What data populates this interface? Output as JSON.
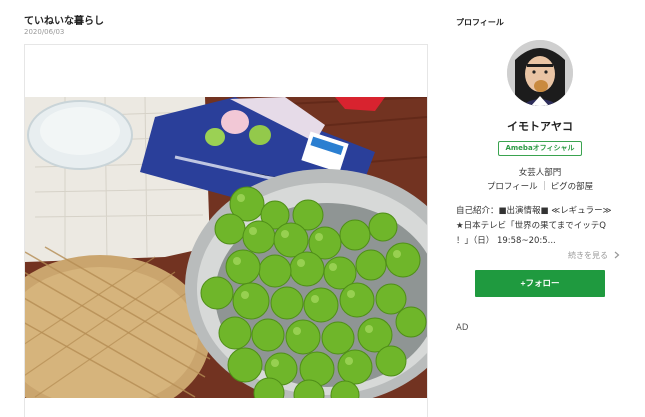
{
  "post": {
    "title": "ていねいな暮らし",
    "date": "2020/06/03"
  },
  "sidebar": {
    "heading": "プロフィール",
    "name": "イモトアヤコ",
    "badge": "Amebaオフィシャル",
    "category": "女芸人部門",
    "links": [
      {
        "label": "プロフィール"
      },
      {
        "label": "ピグの部屋"
      }
    ],
    "intro_lines": [
      "自己紹介：■出演情報■ ≪レギュラー≫",
      "★日本テレビ「世界の果てまでイッテQ",
      "！」（日） 19:58~20:5..."
    ],
    "more_label": "続きを見る",
    "more_icon": "chevron-right-icon",
    "follow_label": "+フォロー",
    "follow_color": "#1f9a3f",
    "ad_label": "AD"
  }
}
